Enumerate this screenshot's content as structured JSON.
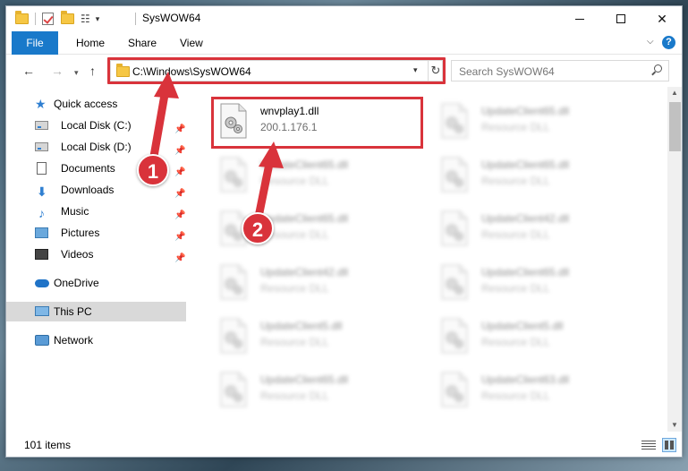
{
  "window": {
    "title": "SysWOW64"
  },
  "ribbon": {
    "tabs": [
      "File",
      "Home",
      "Share",
      "View"
    ]
  },
  "navigation": {
    "address": "C:\\Windows\\SysWOW64",
    "search_placeholder": "Search SysWOW64"
  },
  "sidebar": {
    "items": [
      {
        "label": "Quick access",
        "icon": "star-icon"
      },
      {
        "label": "Local Disk (C:)",
        "icon": "disk-icon"
      },
      {
        "label": "Local Disk (D:)",
        "icon": "disk-icon"
      },
      {
        "label": "Documents",
        "icon": "documents-icon"
      },
      {
        "label": "Downloads",
        "icon": "download-icon"
      },
      {
        "label": "Music",
        "icon": "music-icon"
      },
      {
        "label": "Pictures",
        "icon": "pictures-icon"
      },
      {
        "label": "Videos",
        "icon": "videos-icon"
      },
      {
        "label": "OneDrive",
        "icon": "cloud-icon"
      },
      {
        "label": "This PC",
        "icon": "computer-icon"
      },
      {
        "label": "Network",
        "icon": "network-icon"
      }
    ]
  },
  "files": [
    {
      "name": "wnvplay1.dll",
      "desc": "200.1.176.1"
    },
    {
      "name": "UpdateClient65.dll",
      "desc": "Resource DLL"
    },
    {
      "name": "UpdateClient65.dll",
      "desc": "Resource DLL"
    },
    {
      "name": "UpdateClient65.dll",
      "desc": "Resource DLL"
    },
    {
      "name": "UpdateClient65.dll",
      "desc": "Resource DLL"
    },
    {
      "name": "UpdateClient42.dll",
      "desc": "Resource DLL"
    },
    {
      "name": "UpdateClient42.dll",
      "desc": "Resource DLL"
    },
    {
      "name": "UpdateClient65.dll",
      "desc": "Resource DLL"
    },
    {
      "name": "UpdateClient5.dll",
      "desc": "Resource DLL"
    },
    {
      "name": "UpdateClient5.dll",
      "desc": "Resource DLL"
    },
    {
      "name": "UpdateClient65.dll",
      "desc": "Resource DLL"
    },
    {
      "name": "UpdateClient63.dll",
      "desc": "Resource DLL"
    }
  ],
  "status": {
    "item_count": "101 items"
  },
  "annotations": {
    "step1": "1",
    "step2": "2"
  },
  "colors": {
    "accent": "#1979ca",
    "highlight": "#d9333b",
    "selection": "#cce8ff"
  }
}
